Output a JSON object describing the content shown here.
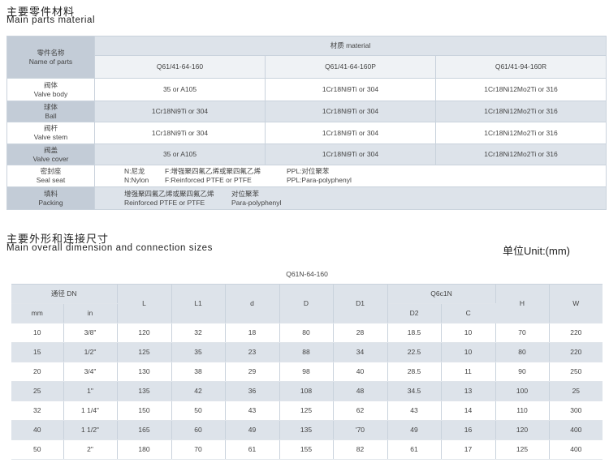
{
  "section1": {
    "title_cn": "主要零件材料",
    "title_en": "Main parts material"
  },
  "materials_table": {
    "name_header_cn": "零件名称",
    "name_header_en": "Name of parts",
    "material_header": "材质  material",
    "models": [
      "Q61/41-64-160",
      "Q61/41-64-160P",
      "Q61/41-94-160R"
    ],
    "rows": [
      {
        "name_cn": "阀体",
        "name_en": "Valve body",
        "values": [
          "35  or  A105",
          "1Cr18Ni9Ti  or 304",
          "1Cr18Ni12Mo2Ti  or 316"
        ]
      },
      {
        "name_cn": "球体",
        "name_en": "Ball",
        "values": [
          "1Cr18Ni9Ti  or 304",
          "1Cr18Ni9Ti  or 304",
          "1Cr18Ni12Mo2Ti  or 316"
        ]
      },
      {
        "name_cn": "阀杆",
        "name_en": "Valve stem",
        "values": [
          "1Cr18Ni9Ti  or 304",
          "1Cr18Ni9Ti  or 304",
          "1Cr18Ni12Mo2Ti  or 316"
        ]
      },
      {
        "name_cn": "阀盖",
        "name_en": "Valve cover",
        "values": [
          "35  or  A105",
          "1Cr18Ni9Ti  or 304",
          "1Cr18Ni12Mo2Ti  or 316"
        ]
      }
    ],
    "seal": {
      "name_cn": "密封座",
      "name_en": "Seal seat",
      "line1": [
        "N:尼龙",
        "F:增强聚四氟乙烯或聚四氟乙烯",
        "PPL:对位聚苯"
      ],
      "line2": [
        "N:Nylon",
        "F:Reinforced PTFE or PTFE",
        "PPL:Para-polyphenyl"
      ]
    },
    "packing": {
      "name_cn": "填料",
      "name_en": "Packing",
      "line1": [
        "增强聚四氟乙烯或聚四氟乙烯",
        "对位聚苯"
      ],
      "line2": [
        "Reinforced PTFE or PTFE",
        "Para-polyphenyl"
      ]
    }
  },
  "section2": {
    "title_cn": "主要外形和连接尺寸",
    "title_en": "Main overall dimension and connection sizes",
    "unit": "单位Unit:(mm)"
  },
  "dimension_table": {
    "model": "Q61N-64-160",
    "dn_header": "通径 DN",
    "mm": "mm",
    "in": "in",
    "L": "L",
    "L1": "L1",
    "d": "d",
    "D": "D",
    "D1": "D1",
    "group": "Q6c1N",
    "D2": "D2",
    "C": "C",
    "H": "H",
    "W": "W",
    "rows": [
      [
        "10",
        "3/8\"",
        "120",
        "32",
        "18",
        "80",
        "28",
        "18.5",
        "10",
        "70",
        "220"
      ],
      [
        "15",
        "1/2\"",
        "125",
        "35",
        "23",
        "88",
        "34",
        "22.5",
        "10",
        "80",
        "220"
      ],
      [
        "20",
        "3/4\"",
        "130",
        "38",
        "29",
        "98",
        "40",
        "28.5",
        "11",
        "90",
        "250"
      ],
      [
        "25",
        "1\"",
        "135",
        "42",
        "36",
        "108",
        "48",
        "34.5",
        "13",
        "100",
        "25"
      ],
      [
        "32",
        "1 1/4\"",
        "150",
        "50",
        "43",
        "125",
        "62",
        "43",
        "14",
        "110",
        "300"
      ],
      [
        "40",
        "1 1/2\"",
        "165",
        "60",
        "49",
        "135",
        "'70",
        "49",
        "16",
        "120",
        "400"
      ],
      [
        "50",
        "2\"",
        "180",
        "70",
        "61",
        "155",
        "82",
        "61",
        "17",
        "125",
        "400"
      ]
    ]
  }
}
